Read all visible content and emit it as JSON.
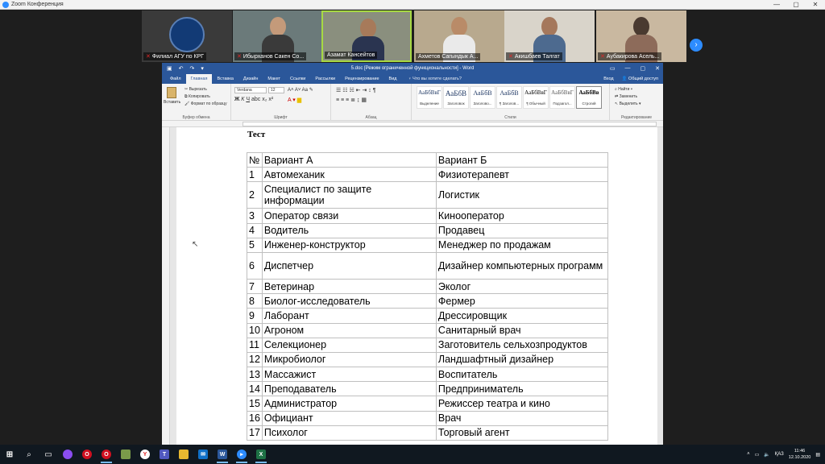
{
  "zoom": {
    "title": "Zoom Конференция",
    "participants": [
      {
        "name": "Филиал АГУ по КРГ",
        "type": "logo"
      },
      {
        "name": "Ибырханов Сакен Со...",
        "type": "video"
      },
      {
        "name": "Азамат Кансейтов",
        "type": "video",
        "active": true
      },
      {
        "name": "Ахметов Сагындык А...",
        "type": "video"
      },
      {
        "name": "Акишбаев Талгат",
        "type": "video"
      },
      {
        "name": "Аубакирова Асель...",
        "type": "video"
      }
    ]
  },
  "word": {
    "window_title": "5.doc [Режим ограниченной функциональности] - Word",
    "tabs": [
      "Файл",
      "Главная",
      "Вставка",
      "Дизайн",
      "Макет",
      "Ссылки",
      "Рассылки",
      "Рецензирование",
      "Вид"
    ],
    "tell_me": "Что вы хотите сделать?",
    "signin": "Вход",
    "share": "Общий доступ",
    "ribbon": {
      "paste": "Вставить",
      "cut": "Вырезать",
      "copy": "Копировать",
      "format_painter": "Формат по образцу",
      "clipboard_group": "Буфер обмена",
      "font_name": "Verdana",
      "font_size": "12",
      "font_group": "Шрифт",
      "paragraph_group": "Абзац",
      "styles_group": "Стили",
      "editing_group": "Редактирование",
      "find": "Найти",
      "replace": "Заменить",
      "select": "Выделить",
      "styles": [
        {
          "sample": "АаБбВвГ",
          "name": "Выделение"
        },
        {
          "sample": "АаБбВ",
          "name": "Заголовок"
        },
        {
          "sample": "АаБбВ",
          "name": "Заголово..."
        },
        {
          "sample": "АаБбВ",
          "name": "¶ Заголов..."
        },
        {
          "sample": "АаБбВвГ",
          "name": "¶ Обычный"
        },
        {
          "sample": "АаБбВвГ",
          "name": "Подзагол..."
        },
        {
          "sample": "АаБбВв",
          "name": "Строгий"
        }
      ]
    }
  },
  "document": {
    "heading": "Тест",
    "columns": [
      "№",
      "Вариант А",
      "Вариант Б"
    ],
    "rows": [
      [
        "1",
        "Автомеханик",
        "Физиотерапевт"
      ],
      [
        "2",
        "Специалист по защите информации",
        "Логистик"
      ],
      [
        "3",
        "Оператор связи",
        "Кинооператор"
      ],
      [
        "4",
        "Водитель",
        "Продавец"
      ],
      [
        "5",
        "Инженер-конструктор",
        "Менеджер по продажам"
      ],
      [
        "6",
        "Диспетчер",
        "Дизайнер компьютерных программ"
      ],
      [
        "7",
        "Ветеринар",
        "Эколог"
      ],
      [
        "8",
        "Биолог-исследователь",
        "Фермер"
      ],
      [
        "9",
        "Лаборант",
        "Дрессировщик"
      ],
      [
        "10",
        "Агроном",
        "Санитарный врач"
      ],
      [
        "11",
        "Селекционер",
        "Заготовитель сельхозпродуктов"
      ],
      [
        "12",
        "Микробиолог",
        "Ландшафтный дизайнер"
      ],
      [
        "13",
        "Массажист",
        "Воспитатель"
      ],
      [
        "14",
        "Преподаватель",
        "Предприниматель"
      ],
      [
        "15",
        "Администратор",
        "Режиссер театра и кино"
      ],
      [
        "16",
        "Официант",
        "Врач"
      ],
      [
        "17",
        "Психолог",
        "Торговый агент"
      ]
    ]
  },
  "taskbar": {
    "lang": "ҚАЗ",
    "time": "11:46",
    "date": "12.10.2020"
  }
}
